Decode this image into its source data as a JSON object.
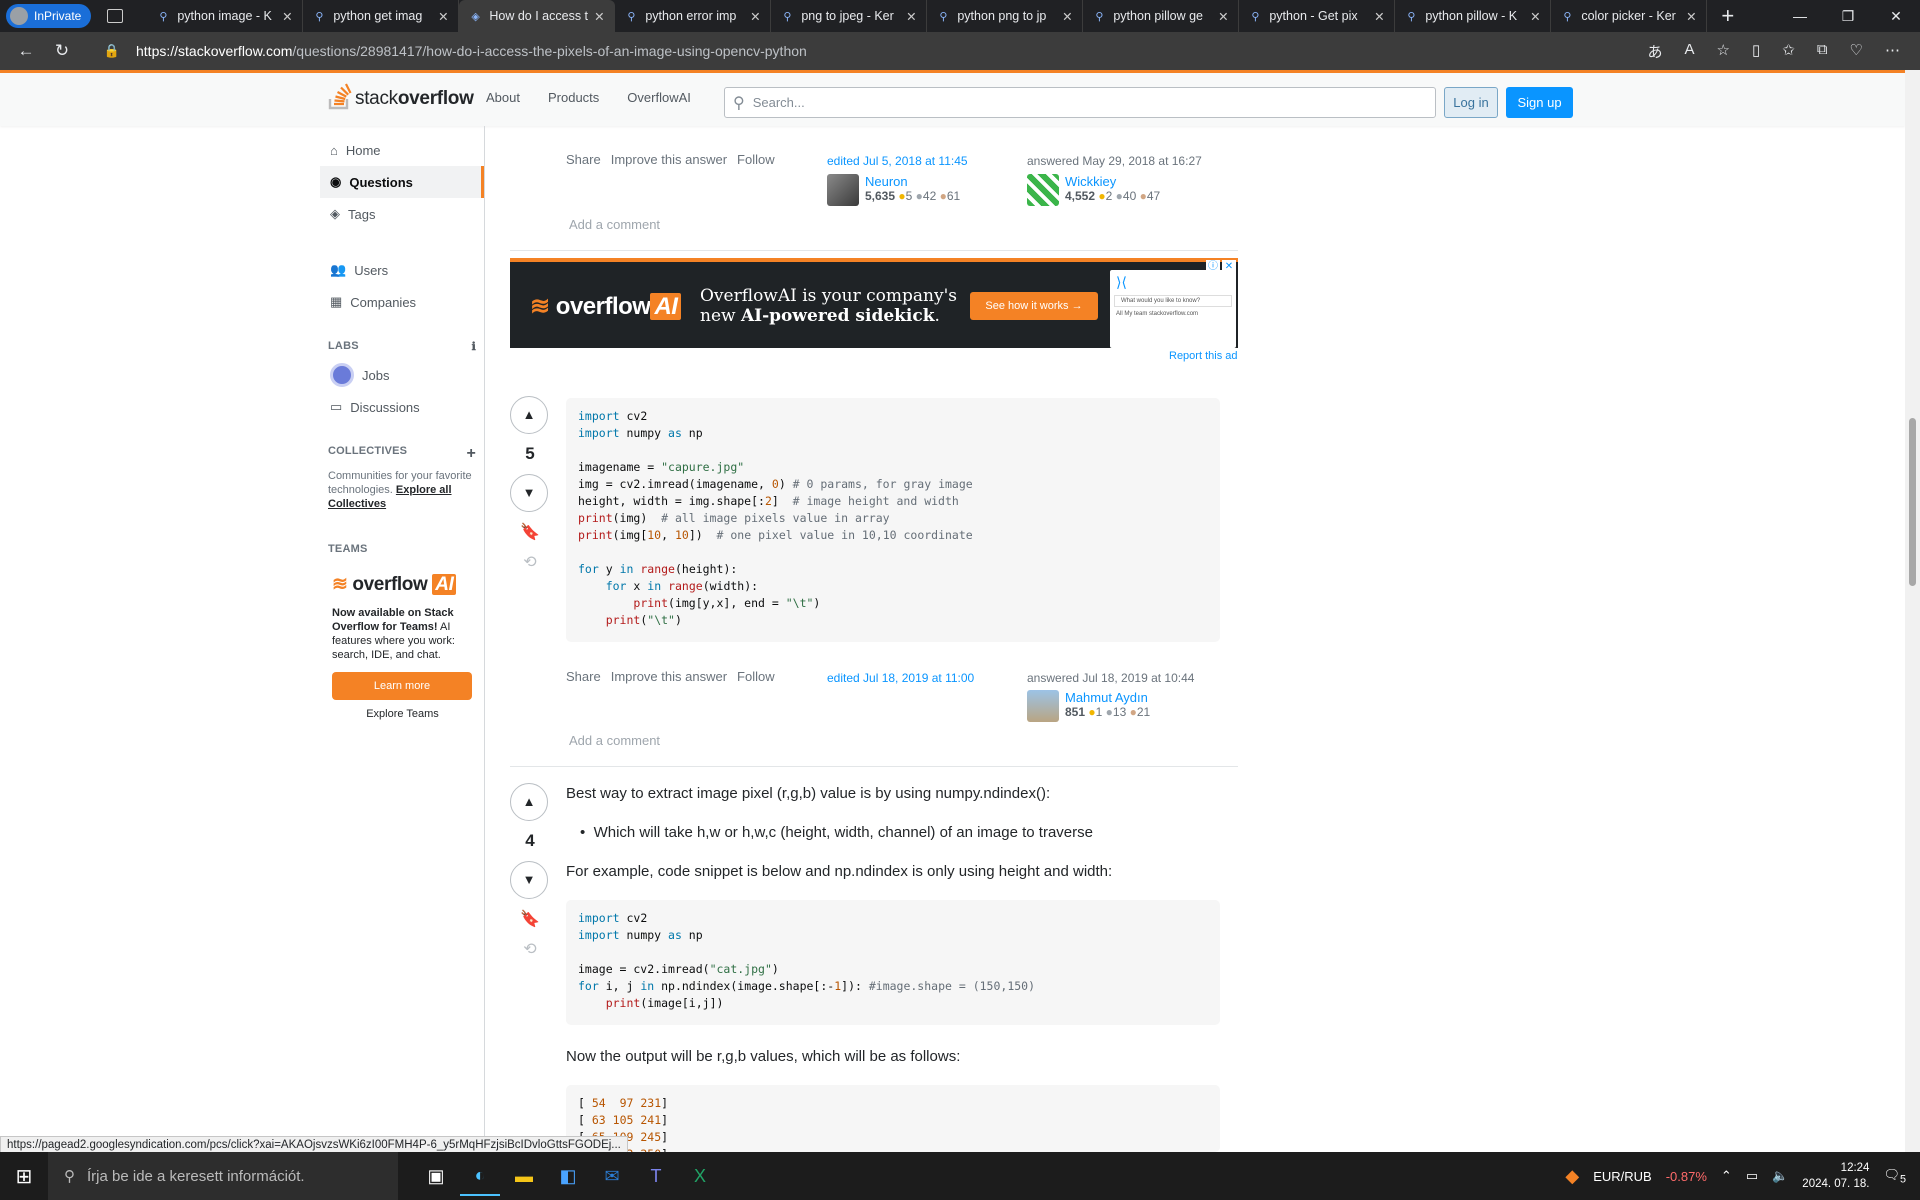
{
  "browser": {
    "inprivate": "InPrivate",
    "tabs": [
      {
        "title": "python image - K",
        "active": false
      },
      {
        "title": "python get imag",
        "active": false
      },
      {
        "title": "How do I access t",
        "active": true
      },
      {
        "title": "python error imp",
        "active": false
      },
      {
        "title": "png to jpeg - Ker",
        "active": false
      },
      {
        "title": "python png to jp",
        "active": false
      },
      {
        "title": "python pillow ge",
        "active": false
      },
      {
        "title": "python - Get pix",
        "active": false
      },
      {
        "title": "python pillow - K",
        "active": false
      },
      {
        "title": "color picker - Ker",
        "active": false
      }
    ],
    "url_host": "https://stackoverflow.com",
    "url_path": "/questions/28981417/how-do-i-access-the-pixels-of-an-image-using-opencv-python"
  },
  "so": {
    "logo_light": "stack",
    "logo_bold": "overflow",
    "nav": [
      "About",
      "Products",
      "OverflowAI"
    ],
    "search_placeholder": "Search...",
    "login": "Log in",
    "signup": "Sign up"
  },
  "sidebar": {
    "home": "Home",
    "questions": "Questions",
    "tags": "Tags",
    "users": "Users",
    "companies": "Companies",
    "labs_title": "LABS",
    "jobs": "Jobs",
    "discussions": "Discussions",
    "collectives_title": "COLLECTIVES",
    "collectives_text": "Communities for your favorite technologies.",
    "collectives_link": "Explore all Collectives",
    "teams_title": "TEAMS",
    "teams_logo_a": "overflow",
    "teams_logo_b": "AI",
    "teams_text_bold": "Now available on Stack Overflow for Teams!",
    "teams_text": "AI features where you work: search, IDE, and chat.",
    "learn_more": "Learn more",
    "explore_teams": "Explore Teams"
  },
  "answer_prev": {
    "share": "Share",
    "improve": "Improve this answer",
    "follow": "Follow",
    "edited": "edited Jul 5, 2018 at 11:45",
    "editor_name": "Neuron",
    "editor_rep": "5,635",
    "editor_gold": "5",
    "editor_silver": "42",
    "editor_bronze": "61",
    "answered": "answered May 29, 2018 at 16:27",
    "author_name": "Wickkiey",
    "author_rep": "4,552",
    "author_gold": "2",
    "author_silver": "40",
    "author_bronze": "47",
    "add_comment": "Add a comment"
  },
  "ad": {
    "logo_a": "overflow",
    "logo_b": "AI",
    "headline_1": "OverflowAI is your company's",
    "headline_2a": "new ",
    "headline_2b": "AI-powered sidekick",
    "headline_2c": ".",
    "button": "See how it works",
    "preview_q": "What would you like to know?",
    "preview_opts": "All   My team   stackoverflow.com",
    "report": "Report this ad"
  },
  "answer1": {
    "votes": "5",
    "share": "Share",
    "improve": "Improve this answer",
    "follow": "Follow",
    "edited": "edited Jul 18, 2019 at 11:00",
    "answered": "answered Jul 18, 2019 at 10:44",
    "author_name": "Mahmut Aydın",
    "author_rep": "851",
    "author_gold": "1",
    "author_silver": "13",
    "author_bronze": "21",
    "add_comment": "Add a comment"
  },
  "answer2": {
    "votes": "4",
    "p1": "Best way to extract image pixel (r,g,b) value is by using numpy.ndindex():",
    "bullet": "Which will take h,w or h,w,c (height, width, channel) of an image to traverse",
    "p2": "For example, code snippet is below and np.ndindex is only using height and width:",
    "p3": "Now the output will be r,g,b values, which will be as follows:"
  },
  "status_url": "https://pagead2.googlesyndication.com/pcs/click?xai=AKAOjsvzsWKi6zI00FMH4P-6_y5rMqHFzjsiBcIDvloGttsFGODEj...",
  "taskbar": {
    "search": "Írja be ide a keresett információt.",
    "ticker_name": "EUR/RUB",
    "ticker_val": "-0.87%",
    "time": "12:24",
    "date": "2024. 07. 18.",
    "notif": "5"
  }
}
